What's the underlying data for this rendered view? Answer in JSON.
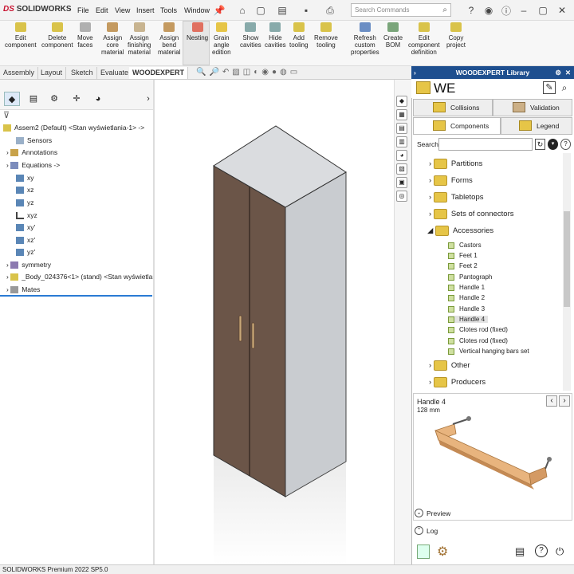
{
  "app": {
    "brand": "SOLIDWORKS",
    "status": "SOLIDWORKS Premium 2022 SP5.0"
  },
  "menu": [
    "File",
    "Edit",
    "View",
    "Insert",
    "Tools",
    "Window"
  ],
  "search": {
    "placeholder": "Search Commands"
  },
  "ribbon": {
    "buttons": [
      {
        "label": "Edit\ncomponent"
      },
      {
        "label": "Delete\ncomponent"
      },
      {
        "label": "Move\nfaces"
      },
      {
        "label": "Assign\ncore\nmaterial"
      },
      {
        "label": "Assign\nfinishing\nmaterial"
      },
      {
        "label": "Assign\nbend\nmaterial"
      },
      {
        "label": "Nesting"
      },
      {
        "label": "Grain\nangle\nedition"
      },
      {
        "label": "Show\ncavities"
      },
      {
        "label": "Hide\ncavities"
      },
      {
        "label": "Add\ntooling"
      },
      {
        "label": "Remove\ntooling"
      },
      {
        "label": "Refresh\ncustom\nproperties"
      },
      {
        "label": "Create\nBOM"
      },
      {
        "label": "Edit\ncomponent\ndefinition"
      },
      {
        "label": "Copy\nproject"
      }
    ]
  },
  "cmdtabs": [
    "Assembly",
    "Layout",
    "Sketch",
    "Evaluate",
    "WOODEXPERT"
  ],
  "tree": {
    "root": "Assem2 (Default) <Stan wyświetlania-1> ->",
    "items": [
      "Sensors",
      "Annotations",
      "Equations ->",
      "xy",
      "xz",
      "yz",
      "xyz",
      "xy'",
      "xz'",
      "yz'",
      "symmetry",
      "_Body_024376<1> (stand) <Stan wyświetlani",
      "Mates"
    ]
  },
  "panel": {
    "title": "WOODEXPERT Library",
    "we": "WE",
    "tabs": {
      "collisions": "Collisions",
      "validation": "Validation",
      "components": "Components",
      "legend": "Legend"
    },
    "search_label": "Search",
    "folders": [
      "Partitions",
      "Forms",
      "Tabletops",
      "Sets of connectors",
      "Accessories"
    ],
    "accessories": [
      "Castors",
      "Feet 1",
      "Feet 2",
      "Pantograph",
      "Handle 1",
      "Handle 2",
      "Handle 3",
      "Handle 4",
      "Clotes rod (fixed)",
      "Clotes rod (fixed)",
      "Vertical hanging bars set"
    ],
    "folders_after": [
      "Other",
      "Producers"
    ],
    "preview": {
      "name": "Handle 4",
      "size": "128 mm",
      "label": "Preview"
    },
    "log_label": "Log"
  },
  "colors": {
    "panel_header": "#1e4f8f",
    "cabinet_front": "#6b5548",
    "cabinet_side": "#c9ccd0",
    "cabinet_top": "#dadcdf",
    "handle_wood": "#e8b47e"
  }
}
